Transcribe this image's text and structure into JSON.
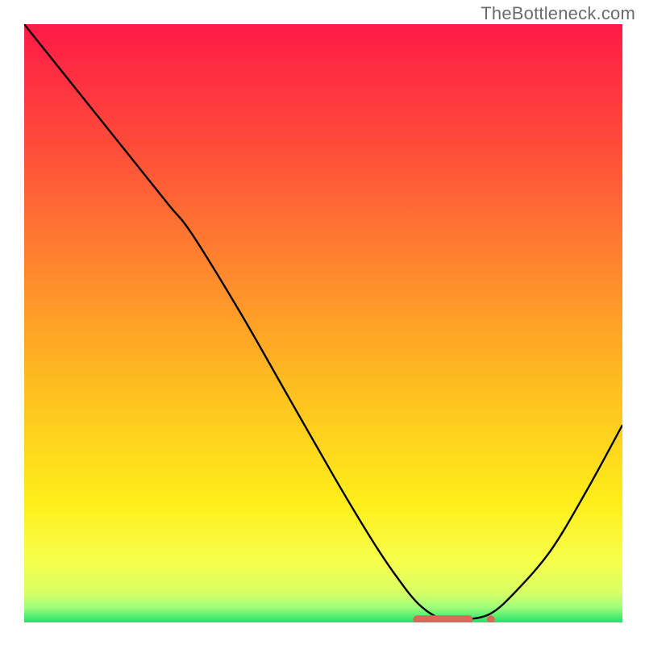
{
  "watermark": "TheBottleneck.com",
  "colors": {
    "gradient_stops": [
      {
        "offset": 0.0,
        "color": "#ff1a47"
      },
      {
        "offset": 0.2,
        "color": "#ff4b3a"
      },
      {
        "offset": 0.42,
        "color": "#ff8a2d"
      },
      {
        "offset": 0.62,
        "color": "#ffc21f"
      },
      {
        "offset": 0.8,
        "color": "#ffee1a"
      },
      {
        "offset": 0.9,
        "color": "#f6ff4d"
      },
      {
        "offset": 0.95,
        "color": "#d8ff66"
      },
      {
        "offset": 0.975,
        "color": "#9fff7a"
      },
      {
        "offset": 1.0,
        "color": "#22e06a"
      }
    ],
    "outer_frame": "#ffffff",
    "curve": "#000000",
    "marker_fill": "#d86a5a",
    "marker_stroke": "#b84f42"
  },
  "chart_data": {
    "type": "line",
    "title": "",
    "xlabel": "",
    "ylabel": "",
    "xlim": [
      0,
      100
    ],
    "ylim": [
      0,
      100
    ],
    "grid": false,
    "legend": false,
    "series": [
      {
        "name": "bottleneck-curve",
        "x": [
          0,
          8,
          16,
          24,
          28,
          36,
          44,
          52,
          58,
          62,
          66,
          70,
          74,
          78,
          82,
          88,
          94,
          100
        ],
        "y": [
          100,
          90,
          80,
          70,
          65,
          52,
          38,
          24,
          14,
          8,
          3,
          0.5,
          0.5,
          1.5,
          5,
          12,
          22,
          33
        ]
      }
    ],
    "markers": {
      "name": "optimal-band",
      "x": [
        65,
        67,
        69,
        71,
        73,
        75,
        78
      ],
      "y": [
        0.5,
        0.5,
        0.5,
        0.5,
        0.5,
        0.5,
        0.5
      ]
    }
  }
}
